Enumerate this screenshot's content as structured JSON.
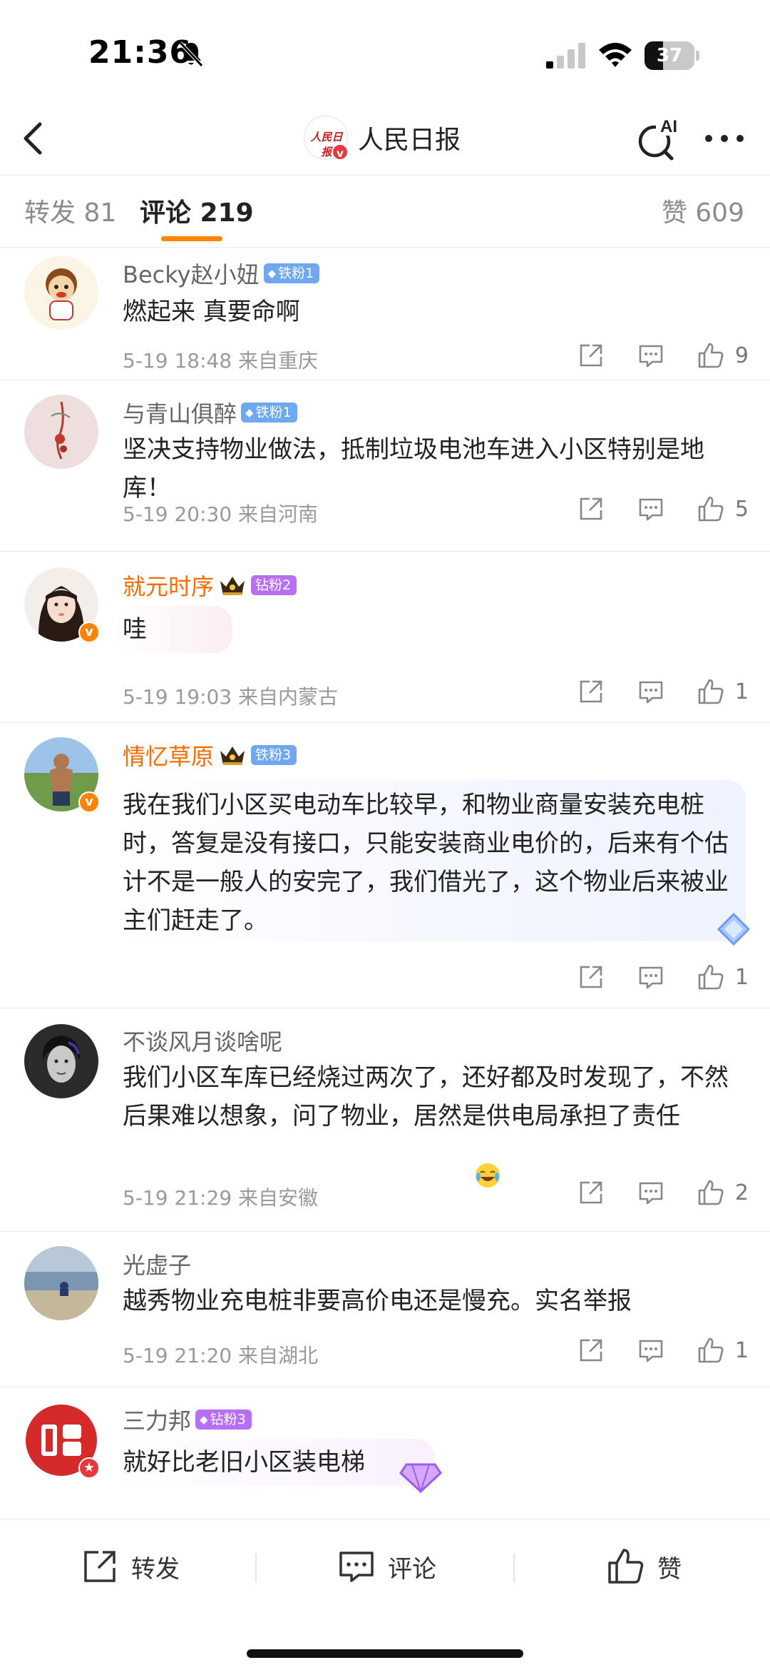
{
  "status_bar": {
    "time": "21:36",
    "battery": "37",
    "battery_level": 0.37
  },
  "nav": {
    "title": "人民日报",
    "back_icon": "chevron-left-icon",
    "ai_label": "AI",
    "more_icon": "more-dots-icon",
    "logo_text": "人民日报"
  },
  "tabs": {
    "repost": "转发 81",
    "comment": "评论 219",
    "likes": "赞 609"
  },
  "comments": [
    {
      "username": "Becky赵小妞",
      "badge": "铁粉1",
      "text": "燃起来 真要命啊",
      "meta": "5-19 18:48 来自重庆",
      "likes": "9"
    },
    {
      "username": "与青山俱醉",
      "badge": "铁粉1",
      "text": "坚决支持物业做法，抵制垃圾电池车进入小区特别是地库！",
      "meta": "5-19 20:30 来自河南",
      "likes": "5"
    },
    {
      "username": "就元时序",
      "badge": "钻粉2",
      "text": "哇",
      "meta": "5-19 19:03 来自内蒙古",
      "likes": "1"
    },
    {
      "username": "情忆草原",
      "badge": "铁粉3",
      "text": "我在我们小区买电动车比较早，和物业商量安装充电桩时，答复是没有接口，只能安装商业电价的，后来有个估计不是一般人的安完了，我们借光了，这个物业后来被业主们赶走了。",
      "meta": "",
      "likes": "1"
    },
    {
      "username": "不谈风月谈啥呢",
      "badge": "",
      "text": "我们小区车库已经烧过两次了，还好都及时发现了，不然后果难以想象，问了物业，居然是供电局承担了责任",
      "meta": "5-19 21:29 来自安徽",
      "likes": "2"
    },
    {
      "username": "光虚子",
      "badge": "",
      "text": "越秀物业充电桩非要高价电还是慢充。实名举报",
      "meta": "5-19 21:20 来自湖北",
      "likes": "1"
    },
    {
      "username": "三力邦",
      "badge": "钻粉3",
      "text": "就好比老旧小区装电梯",
      "meta": "",
      "likes": ""
    }
  ],
  "bottom_bar": {
    "repost": "转发",
    "comment": "评论",
    "like": "赞"
  },
  "colors": {
    "accent": "#ff8200",
    "vip_name": "#ff6a00",
    "iron_badge": "#6fa8f0",
    "diamond_badge": "#b86ff5"
  }
}
